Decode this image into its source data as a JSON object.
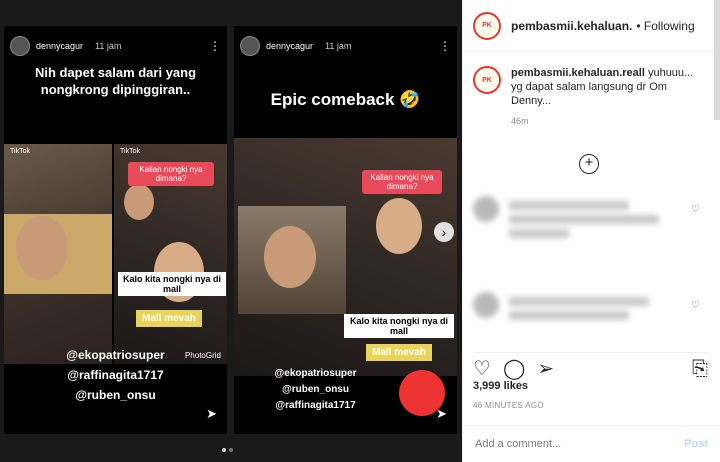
{
  "stories": [
    {
      "user": "dennycagur",
      "time": "11 jam",
      "caption": "Nih dapet salam dari yang nongkrong dipinggiran..",
      "tiktok": "TikTok",
      "bubble": "Kalian nongki nya dimana?",
      "label": "Kalo kita nongki nya di mall",
      "yellow": "Mall mevah",
      "watermark": "PhotoGrid",
      "tags": [
        "@ekopatriosuper",
        "@raffinagita1717",
        "@ruben_onsu"
      ]
    },
    {
      "user": "dennycagur",
      "time": "11 jam",
      "caption": "Epic comeback 🤣",
      "bubble": "Kalian nongki nya dimana?",
      "label": "Kalo kita nongki nya di mall",
      "yellow": "Mall mevah",
      "tags": [
        "@ekopatriosuper",
        "@ruben_onsu",
        "@raffinagita1717"
      ]
    }
  ],
  "header": {
    "username": "pembasmii.kehaluan.",
    "follow": "• Following"
  },
  "comment": {
    "username": "pembasmii.kehaluan.reall",
    "text": "yuhuuu... yg dapat salam langsung dr Om Denny...",
    "time": "46m"
  },
  "likes": "3,999 likes",
  "ago": "46 MINUTES AGO",
  "add_comment": {
    "placeholder": "Add a comment...",
    "post": "Post"
  },
  "icons": [
    "heart-icon",
    "comment-icon",
    "share-icon",
    "bookmark-icon",
    "plus-icon",
    "more-icon",
    "send-icon"
  ]
}
